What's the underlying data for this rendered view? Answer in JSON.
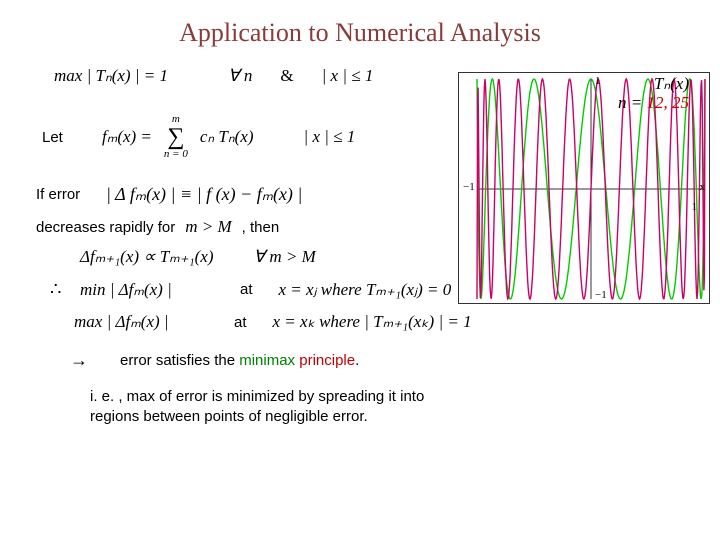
{
  "title": "Application to Numerical Analysis",
  "line1": {
    "max_expr": "max | Tₙ(x) | = 1",
    "forall": "∀ n",
    "amp": "&",
    "absx": "| x | ≤ 1"
  },
  "let": {
    "label": "Let",
    "expr": "fₘ(x) =",
    "sum_top": "m",
    "sum_bot": "n = 0",
    "post": "cₙ Tₙ(x)",
    "cond": "| x | ≤ 1"
  },
  "err": {
    "label": "If error",
    "expr": "| Δ fₘ(x) | ≡ | f (x) − fₘ(x) |"
  },
  "dec": {
    "pre": "decreases rapidly for ",
    "mM": "m > M",
    "post": ", then"
  },
  "prop": {
    "expr": "Δfₘ₊₁(x) ∝ Tₘ₊₁(x)",
    "cond": "∀ m > M"
  },
  "at1": {
    "there": "∴",
    "left": "min | Δfₘ(x) |",
    "at": "at",
    "right": "x = xⱼ  where  Tₘ₊₁(xⱼ) = 0"
  },
  "at2": {
    "left": "max | Δfₘ(x) |",
    "at": "at",
    "right": "x = xₖ  where  | Tₘ₊₁(xₖ) | = 1"
  },
  "arrow": "→",
  "concl": {
    "pre": "error satisfies the ",
    "g": "minimax",
    "sp": " ",
    "r": "principle",
    "post": "."
  },
  "foot": "i. e. ,  max of error is minimized by spreading it into regions between points of negligible error.",
  "chart": {
    "top1": "Tₙ(x)",
    "top2a": "n = ",
    "top2b": "12",
    "top2c": ", ",
    "top2d": "25",
    "x_axis": "x",
    "xmin": "−1",
    "xmax": "1",
    "ymin": "−1",
    "ymax": "1"
  },
  "chart_data": {
    "type": "line",
    "title": "Tₙ(x) for n = 12, 25",
    "xlabel": "x",
    "ylabel": "",
    "xlim": [
      -1,
      1
    ],
    "ylim": [
      -1,
      1
    ],
    "series": [
      {
        "name": "n = 12",
        "freq": 12,
        "color": "#00cc00"
      },
      {
        "name": "n = 25",
        "freq": 25,
        "color": "#cc0066"
      }
    ],
    "note": "Values are cos(n·arccos(x)) sampled on [-1,1]; plotted curves oscillate between -1 and 1."
  }
}
